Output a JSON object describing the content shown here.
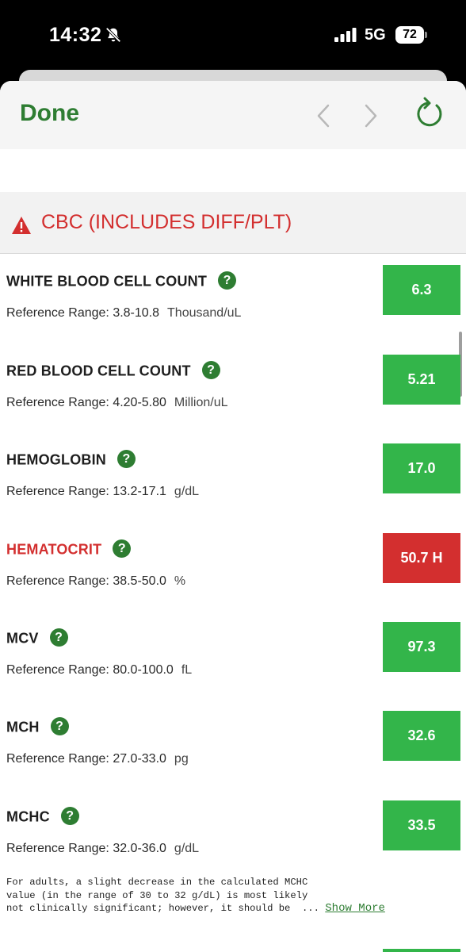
{
  "status": {
    "time": "14:32",
    "network": "5G",
    "battery": "72"
  },
  "nav": {
    "done_label": "Done"
  },
  "section": {
    "title": "CBC (INCLUDES DIFF/PLT)"
  },
  "help_glyph": "?",
  "ref_prefix": "Reference Range:",
  "tests": [
    {
      "name": "WHITE BLOOD CELL COUNT",
      "range": "3.8-10.8",
      "unit": "Thousand/uL",
      "value": "6.3",
      "flag": "normal"
    },
    {
      "name": "RED BLOOD CELL COUNT",
      "range": "4.20-5.80",
      "unit": "Million/uL",
      "value": "5.21",
      "flag": "normal"
    },
    {
      "name": "HEMOGLOBIN",
      "range": "13.2-17.1",
      "unit": "g/dL",
      "value": "17.0",
      "flag": "normal"
    },
    {
      "name": "HEMATOCRIT",
      "range": "38.5-50.0",
      "unit": "%",
      "value": "50.7 H",
      "flag": "high"
    },
    {
      "name": "MCV",
      "range": "80.0-100.0",
      "unit": "fL",
      "value": "97.3",
      "flag": "normal"
    },
    {
      "name": "MCH",
      "range": "27.0-33.0",
      "unit": "pg",
      "value": "32.6",
      "flag": "normal"
    },
    {
      "name": "MCHC",
      "range": "32.0-36.0",
      "unit": "g/dL",
      "value": "33.5",
      "flag": "normal"
    }
  ],
  "note": {
    "line1": "For adults, a slight decrease in the calculated MCHC",
    "line2": "value (in the range of 30 to 32 g/dL) is most likely",
    "line3": "not clinically significant; however, it should be  ...",
    "show_more": "Show More"
  },
  "colors": {
    "accent": "#2e7d32",
    "normal": "#33b54a",
    "high": "#d32f2f"
  }
}
